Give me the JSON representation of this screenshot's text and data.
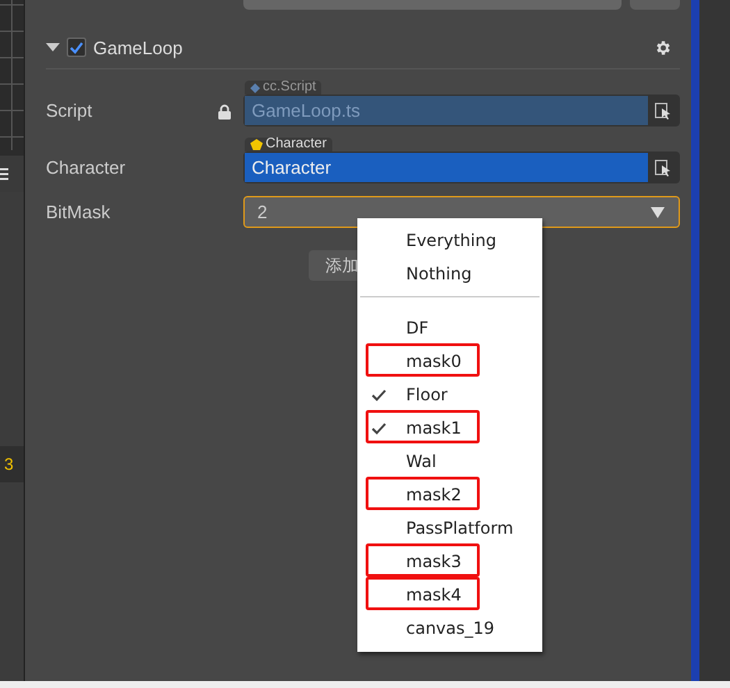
{
  "component": {
    "title": "GameLoop",
    "enabled": true,
    "expanded": true
  },
  "properties": [
    {
      "kind": "asset",
      "label": "Script",
      "locked": true,
      "tag": "cc.Script",
      "value": "GameLoop.ts"
    },
    {
      "kind": "node",
      "label": "Character",
      "locked": false,
      "tag": "Character",
      "value": "Character"
    },
    {
      "kind": "select",
      "label": "BitMask",
      "value": "2",
      "focused": true
    }
  ],
  "add_button": "添加",
  "left_panel": {
    "count": "3"
  },
  "dropdown": {
    "items": [
      {
        "kind": "option",
        "label": "Everything",
        "checked": false,
        "highlighted": false
      },
      {
        "kind": "option",
        "label": "Nothing",
        "checked": false,
        "highlighted": false
      },
      {
        "kind": "separator"
      },
      {
        "kind": "option",
        "label": "DF",
        "checked": false,
        "highlighted": false
      },
      {
        "kind": "option",
        "label": "mask0",
        "checked": false,
        "highlighted": true
      },
      {
        "kind": "option",
        "label": "Floor",
        "checked": true,
        "highlighted": false
      },
      {
        "kind": "option",
        "label": "mask1",
        "checked": true,
        "highlighted": true
      },
      {
        "kind": "option",
        "label": "Wal",
        "checked": false,
        "highlighted": false
      },
      {
        "kind": "option",
        "label": "mask2",
        "checked": false,
        "highlighted": true
      },
      {
        "kind": "option",
        "label": "PassPlatform",
        "checked": false,
        "highlighted": false
      },
      {
        "kind": "option",
        "label": "mask3",
        "checked": false,
        "highlighted": true
      },
      {
        "kind": "option",
        "label": "mask4",
        "checked": false,
        "highlighted": true
      },
      {
        "kind": "option",
        "label": "canvas_19",
        "checked": false,
        "highlighted": false
      }
    ]
  }
}
